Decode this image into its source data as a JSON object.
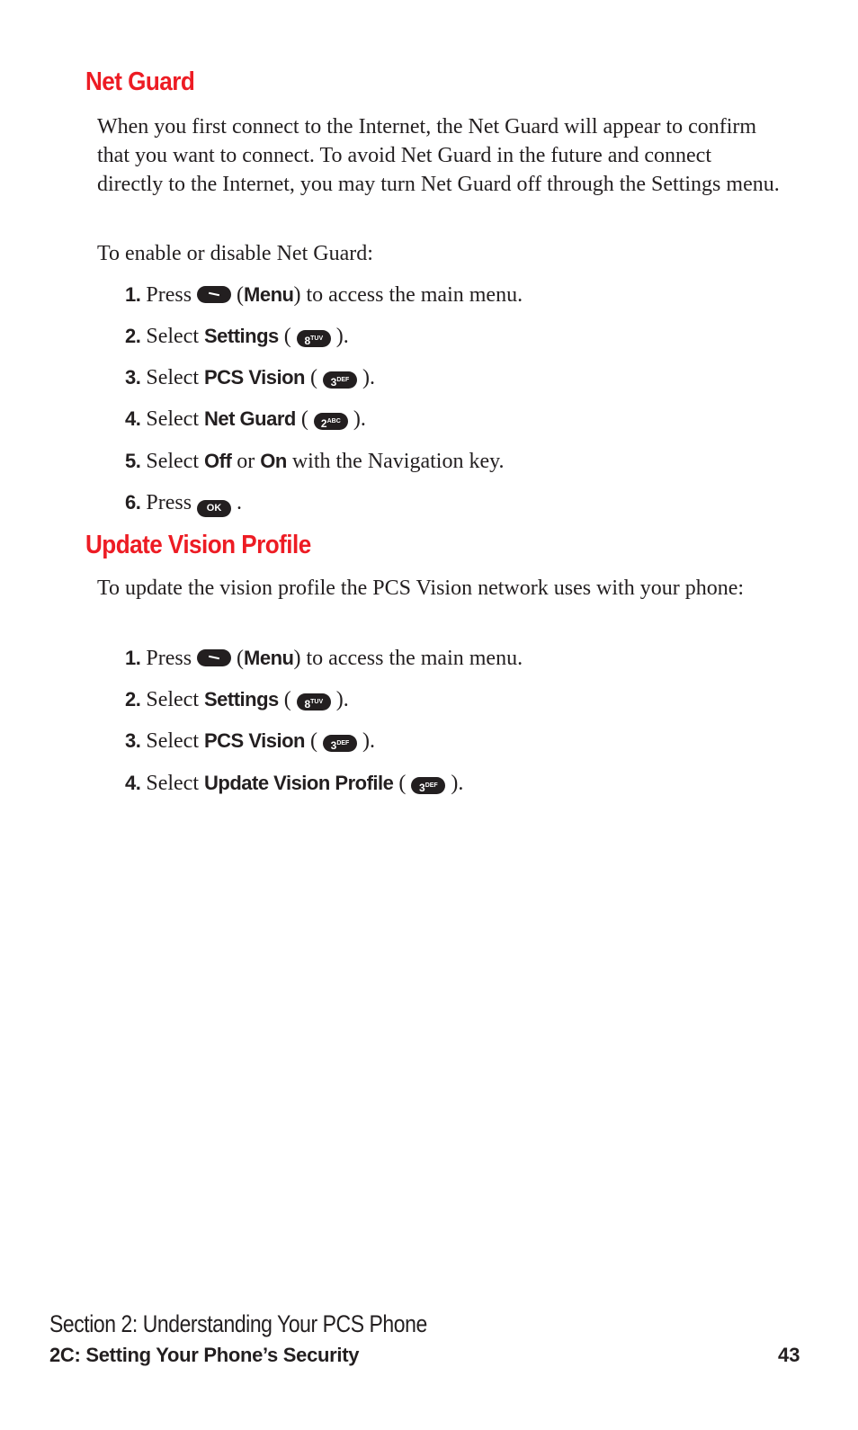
{
  "sections": [
    {
      "heading": "Net Guard",
      "intro": "When you first connect to the Internet, the Net Guard will appear to confirm that you want to connect. To avoid Net Guard in the future and connect directly to the Internet, you may turn Net Guard off through the Settings menu.",
      "lead": "To enable or disable Net Guard:",
      "steps": [
        {
          "n": "1.",
          "pre": "Press",
          "key": "menu-key",
          "bold": "Menu",
          "post": "to access the main menu."
        },
        {
          "n": "2.",
          "pre": "Select",
          "bold": "Settings",
          "key_label": "8",
          "key_sub": "TUV"
        },
        {
          "n": "3.",
          "pre": "Select",
          "bold": "PCS Vision",
          "key_label": "3",
          "key_sub": "DEF"
        },
        {
          "n": "4.",
          "pre": "Select",
          "bold": "Net Guard",
          "key_label": "2",
          "key_sub": "ABC"
        },
        {
          "n": "5.",
          "pre": "Select",
          "bold": "Off",
          "mid": "or",
          "bold2": "On",
          "post": "with the Navigation key."
        },
        {
          "n": "6.",
          "pre": "Press",
          "key_label": "OK"
        }
      ]
    },
    {
      "heading": "Update Vision Profile",
      "intro": "To update the vision profile the PCS Vision network uses with your phone:",
      "steps": [
        {
          "n": "1.",
          "pre": "Press",
          "key": "menu-key",
          "bold": "Menu",
          "post": "to access the main menu."
        },
        {
          "n": "2.",
          "pre": "Select",
          "bold": "Settings",
          "key_label": "8",
          "key_sub": "TUV"
        },
        {
          "n": "3.",
          "pre": "Select",
          "bold": "PCS Vision",
          "key_label": "3",
          "key_sub": "DEF"
        },
        {
          "n": "4.",
          "pre": "Select",
          "bold": "Update Vision Profile",
          "key_label": "3",
          "key_sub": "DEF"
        }
      ]
    }
  ],
  "footer": {
    "section": "Section 2: Understanding Your PCS Phone",
    "chapter": "2C: Setting Your Phone’s Security",
    "page": "43"
  },
  "colors": {
    "heading": "#ed1c24",
    "text": "#231f20"
  }
}
